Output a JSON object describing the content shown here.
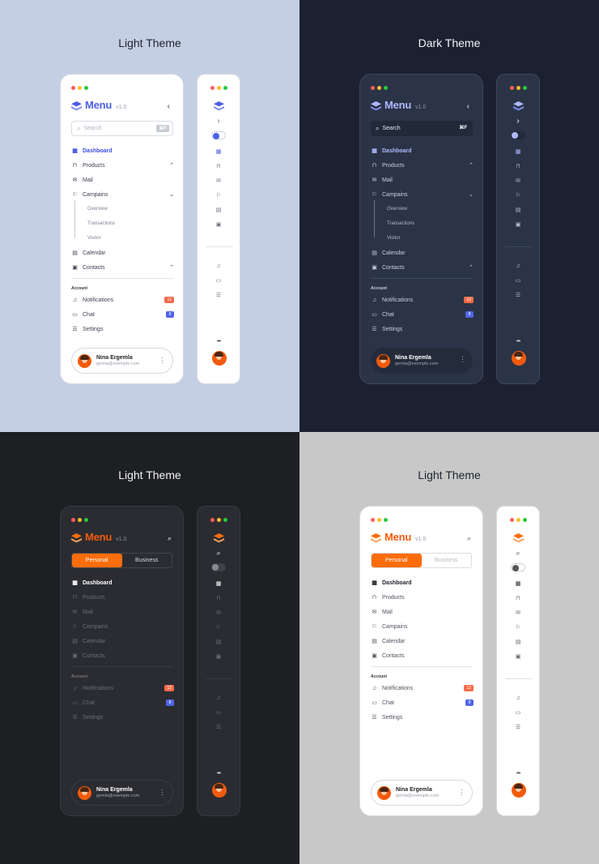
{
  "themes": [
    {
      "title": "Light Theme"
    },
    {
      "title": "Dark Theme"
    },
    {
      "title": "Light Theme"
    },
    {
      "title": "Light Theme"
    }
  ],
  "brand": {
    "name": "Menu",
    "version": "v1.0"
  },
  "search": {
    "placeholder": "Search",
    "shortcut": "⌘F"
  },
  "segments": {
    "personal": "Personal",
    "business": "Business"
  },
  "nav": {
    "dashboard": "Dashboard",
    "products": "Products",
    "mail": "Mail",
    "campaigns": "Campains",
    "overview": "Overview",
    "transactions": "Transactions",
    "visitor": "Visitor",
    "calendar": "Calendar",
    "contacts": "Contacts"
  },
  "account": {
    "section": "Account",
    "notifications": "Notifications",
    "notifications_badge": "12",
    "chat": "Chat",
    "chat_badge": "8",
    "settings": "Settings"
  },
  "user": {
    "name": "Nina Ergemla",
    "email": "gemla@exemple.com"
  },
  "colors": {
    "blue_accent": "#4d5fe6",
    "orange_accent": "#fb6d0c",
    "badge_orange": "#f36b4a",
    "badge_blue": "#5065e8"
  }
}
